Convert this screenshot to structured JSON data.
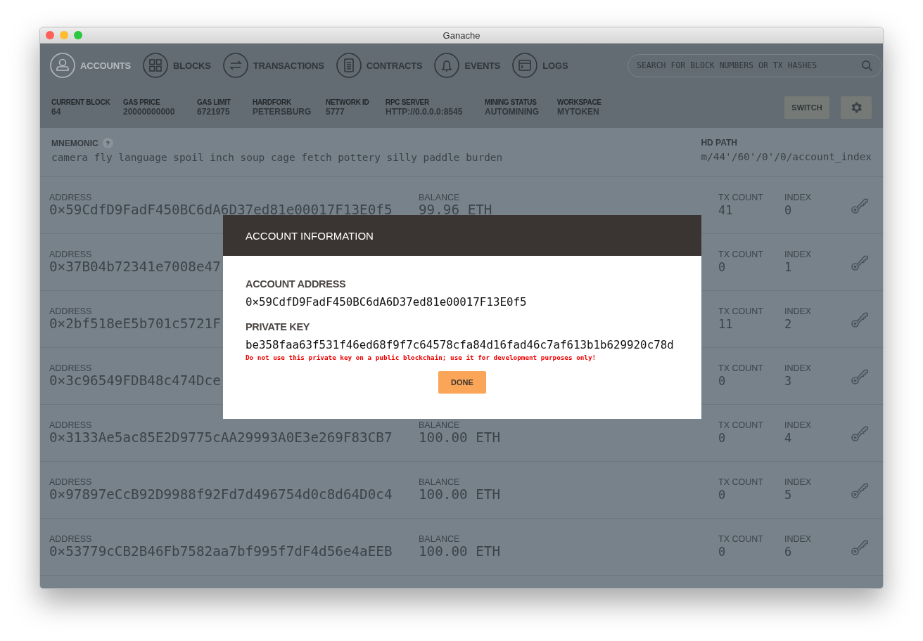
{
  "window": {
    "title": "Ganache"
  },
  "nav": {
    "items": [
      {
        "kind": "person",
        "label": "ACCOUNTS",
        "selected": true
      },
      {
        "kind": "grid",
        "label": "BLOCKS",
        "selected": false
      },
      {
        "kind": "arrows",
        "label": "TRANSACTIONS",
        "selected": false
      },
      {
        "kind": "doc",
        "label": "CONTRACTS",
        "selected": false
      },
      {
        "kind": "bell",
        "label": "EVENTS",
        "selected": false
      },
      {
        "kind": "terminal",
        "label": "LOGS",
        "selected": false
      }
    ],
    "search": {
      "placeholder": "SEARCH FOR BLOCK NUMBERS OR TX HASHES"
    }
  },
  "stats": [
    {
      "label": "CURRENT BLOCK",
      "value": "64"
    },
    {
      "label": "GAS PRICE",
      "value": "20000000000"
    },
    {
      "label": "GAS LIMIT",
      "value": "6721975"
    },
    {
      "label": "HARDFORK",
      "value": "PETERSBURG"
    },
    {
      "label": "NETWORK ID",
      "value": "5777"
    },
    {
      "label": "RPC SERVER",
      "value": "HTTP://0.0.0.0:8545"
    },
    {
      "label": "MINING STATUS",
      "value": "AUTOMINING"
    },
    {
      "label": "WORKSPACE",
      "value": "MYTOKEN"
    }
  ],
  "switch_button": "SWITCH",
  "mnemonic": {
    "label": "MNEMONIC",
    "help": "?",
    "words": "camera fly language spoil inch soup cage fetch pottery silly paddle burden"
  },
  "hd_path": {
    "label": "HD PATH",
    "value": "m/44'/60'/0'/0/account_index"
  },
  "accounts": [
    {
      "address_label": "ADDRESS",
      "address": "0×59CdfD9FadF450BC6dA6D37ed81e00017F13E0f5",
      "balance_label": "BALANCE",
      "balance": "99.96 ETH",
      "tx_count_label": "TX COUNT",
      "tx_count": "41",
      "index_label": "INDEX",
      "index": "0"
    },
    {
      "address_label": "ADDRESS",
      "address": "0×37B04b72341e7008e47",
      "tx_count_label": "TX COUNT",
      "tx_count": "0",
      "index_label": "INDEX",
      "index": "1"
    },
    {
      "address_label": "ADDRESS",
      "address": "0×2bf518eE5b701c5721F",
      "tx_count_label": "TX COUNT",
      "tx_count": "11",
      "index_label": "INDEX",
      "index": "2"
    },
    {
      "address_label": "ADDRESS",
      "address": "0×3c96549FDB48c474Dce",
      "tx_count_label": "TX COUNT",
      "tx_count": "0",
      "index_label": "INDEX",
      "index": "3"
    },
    {
      "address_label": "ADDRESS",
      "address": "0×3133Ae5ac85E2D9775cAA29993A0E3e269F83CB7",
      "balance_label": "BALANCE",
      "balance": "100.00 ETH",
      "tx_count_label": "TX COUNT",
      "tx_count": "0",
      "index_label": "INDEX",
      "index": "4"
    },
    {
      "address_label": "ADDRESS",
      "address": "0×97897eCcB92D9988f92Fd7d496754d0c8d64D0c4",
      "balance_label": "BALANCE",
      "balance": "100.00 ETH",
      "tx_count_label": "TX COUNT",
      "tx_count": "0",
      "index_label": "INDEX",
      "index": "5"
    },
    {
      "address_label": "ADDRESS",
      "address": "0×53779cCB2B46Fb7582aa7bf995f7dF4d56e4aEEB",
      "balance_label": "BALANCE",
      "balance": "100.00 ETH",
      "tx_count_label": "TX COUNT",
      "tx_count": "0",
      "index_label": "INDEX",
      "index": "6"
    }
  ],
  "modal": {
    "title": "ACCOUNT INFORMATION",
    "address_label": "ACCOUNT ADDRESS",
    "address": "0×59CdfD9FadF450BC6dA6D37ed81e00017F13E0f5",
    "key_label": "PRIVATE KEY",
    "key": "be358faa63f531f46ed68f9f7c64578cfa84d16fad46c7af613b1b629920c78d",
    "warning": "Do not use this private key on a public blockchain; use it for development purposes only!",
    "button": "DONE"
  }
}
